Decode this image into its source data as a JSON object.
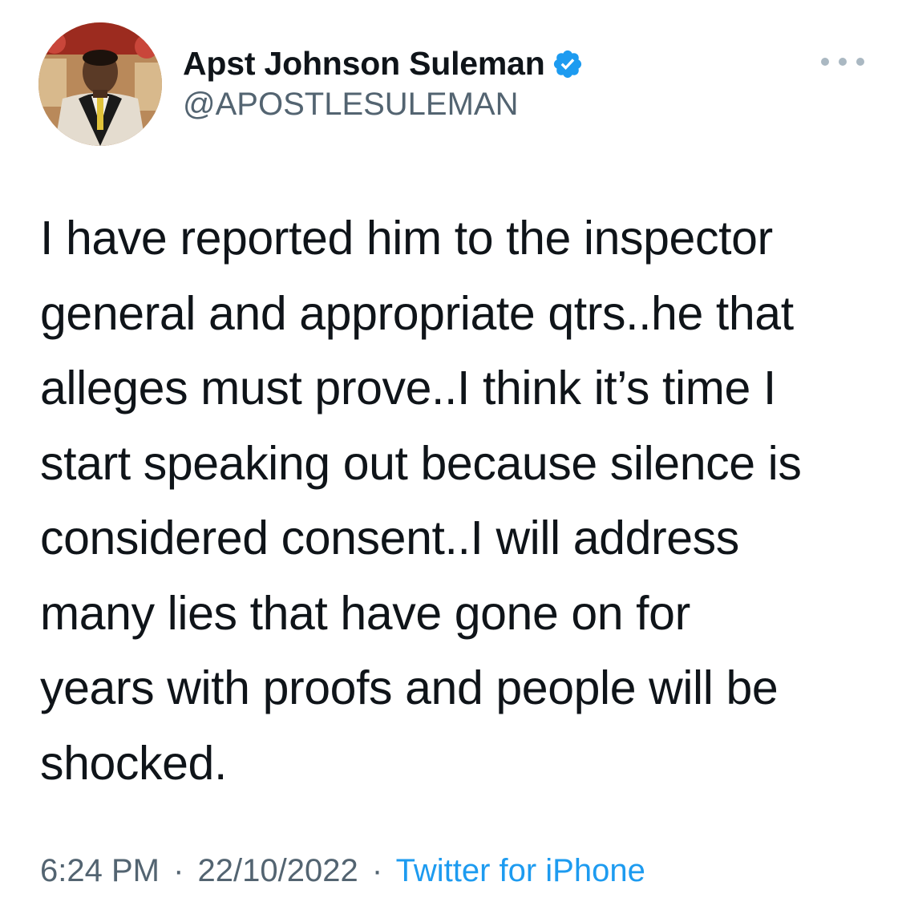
{
  "author": {
    "display_name": "Apst Johnson Suleman",
    "handle": "@APOSTLESULEMAN",
    "verified": true,
    "avatar_icon": "profile-photo"
  },
  "tweet": {
    "text_lines": [
      "I have reported him to the inspector",
      "general and appropriate qtrs..he that",
      "alleges must prove..I think it’s time I",
      "start speaking out because silence is",
      "considered consent..I will address",
      "many lies that have gone on for",
      "years with proofs and people will be",
      "shocked."
    ]
  },
  "meta": {
    "time": "6:24 PM",
    "separator": "·",
    "date": "22/10/2022",
    "source": "Twitter for iPhone"
  },
  "colors": {
    "text": "#0f1419",
    "secondary": "#536471",
    "link": "#1d9bf0",
    "verified_badge": "#1d9bf0"
  },
  "icons": {
    "verified": "verified-badge-icon",
    "more": "more-options-icon"
  }
}
